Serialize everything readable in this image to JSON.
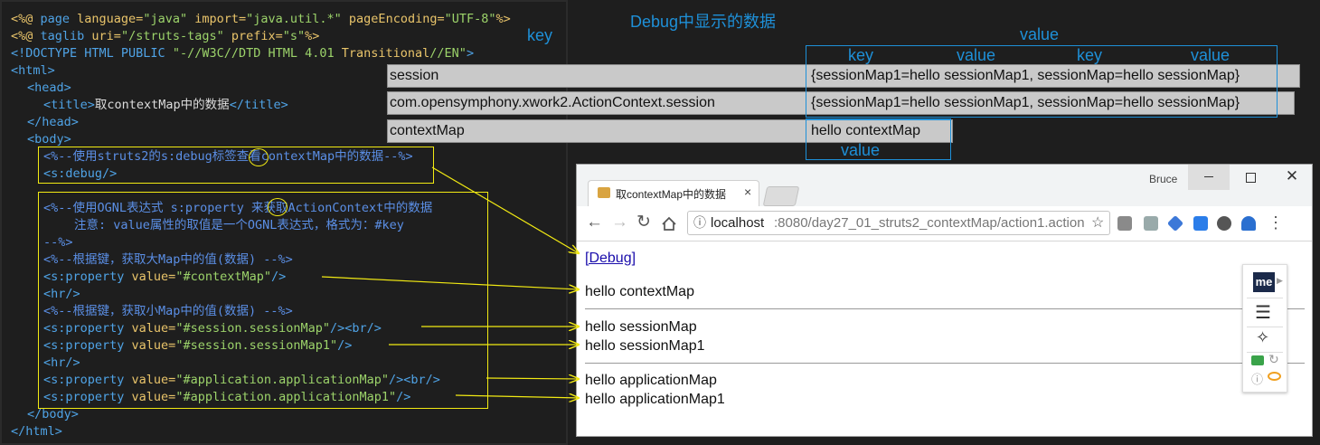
{
  "code": {
    "l1": {
      "a": "<%@ ",
      "b": "page",
      "c": " language=",
      "d": "\"java\"",
      "e": " import=",
      "f": "\"java.util.*\"",
      "g": " pageEncoding=",
      "h": "\"UTF-8\"",
      "i": "%>"
    },
    "l2": {
      "a": "<%@ ",
      "b": "taglib",
      "c": " uri=",
      "d": "\"/struts-tags\"",
      "e": " prefix=",
      "f": "\"s\"",
      "g": "%>"
    },
    "l3": {
      "a": "<!DOCTYPE HTML PUBLIC ",
      "b": "\"-//W3C//DTD HTML 4.01 ",
      "c": "Transitional",
      "d": "//EN\"",
      "e": ">"
    },
    "l4": "<html>",
    "l5": "<head>",
    "l6": {
      "a": "<title>",
      "b": "取contextMap中的数据",
      "c": "</title>"
    },
    "l7": "</head>",
    "l8": "<body>",
    "l9": "<%--使用struts2的s:debug标签查看contextMap中的数据--%>",
    "l10": "<s:debug/>",
    "l11": "<%--使用OGNL表达式 s:property 来获取ActionContext中的数据",
    "l12": "注意: value属性的取值是一个OGNL表达式，格式为：#key",
    "l13": "--%>",
    "l14": "<%--根据键，获取大Map中的值(数据) --%>",
    "l15": {
      "a": "<s:property",
      "b": " value=",
      "c": "\"#contextMap\"",
      "d": "/>"
    },
    "l16": "<hr/>",
    "l17": "<%--根据键，获取小Map中的值(数据) --%>",
    "l18": {
      "a": "<s:property",
      "b": " value=",
      "c": "\"#session.sessionMap\"",
      "d": "/><br/>"
    },
    "l19": {
      "a": "<s:property",
      "b": " value=",
      "c": "\"#session.sessionMap1\"",
      "d": "/>"
    },
    "l20": "<hr/>",
    "l21": {
      "a": "<s:property",
      "b": " value=",
      "c": "\"#application.applicationMap\"",
      "d": "/><br/>"
    },
    "l22": {
      "a": "<s:property",
      "b": " value=",
      "c": "\"#application.applicationMap1\"",
      "d": "/>"
    },
    "l23": "</body>",
    "l24": "</html>"
  },
  "annotations": {
    "title": "Debug中显示的数据",
    "key_left": "key",
    "value_top": "value",
    "key1": "key",
    "value1": "value",
    "key2": "key",
    "value2": "value",
    "value_bottom": "value"
  },
  "debug_rows": [
    {
      "key": "session",
      "value": "{sessionMap1=hello sessionMap1, sessionMap=hello sessionMap}"
    },
    {
      "key": "com.opensymphony.xwork2.ActionContext.session",
      "value": "{sessionMap1=hello sessionMap1, sessionMap=hello sessionMap}"
    },
    {
      "key": "contextMap",
      "value": "hello contextMap"
    }
  ],
  "browser": {
    "user": "Bruce",
    "tab_title": "取contextMap中的数据",
    "tab_close": "×",
    "url_host": "localhost",
    "url_rest": ":8080/day27_01_struts2_contextMap/action1.action",
    "debug_link": "[Debug]",
    "line1": "hello contextMap",
    "line2": "hello sessionMap",
    "line3": "hello sessionMap1",
    "line4": "hello applicationMap",
    "line5": "hello applicationMap1",
    "widget_label": "me"
  },
  "colors": {
    "annotation_blue": "#1e90d8",
    "highlight_yellow": "#f2ea13",
    "editor_bg": "#1e1e1e"
  }
}
